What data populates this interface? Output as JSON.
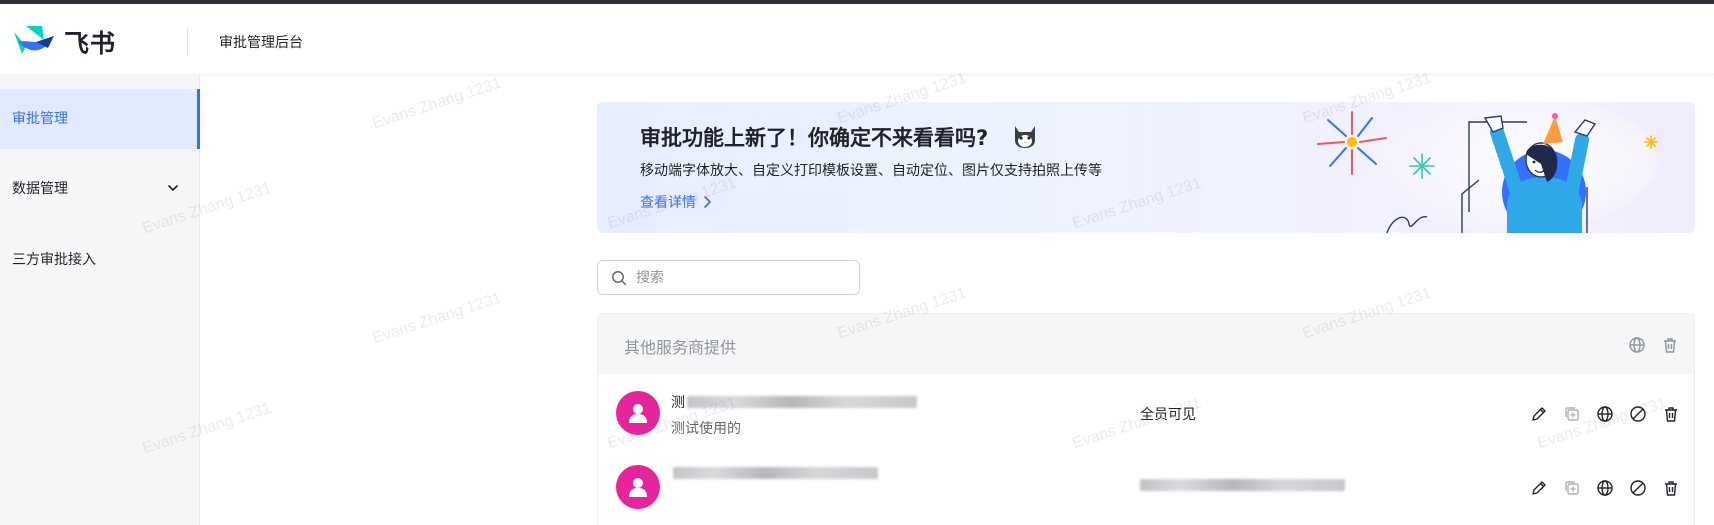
{
  "app": {
    "brand": "飞书",
    "header_title": "审批管理后台"
  },
  "sidebar": {
    "items": [
      {
        "label": "审批管理",
        "active": true
      },
      {
        "label": "数据管理",
        "expandable": true
      },
      {
        "label": "三方审批接入"
      }
    ]
  },
  "banner": {
    "title": "审批功能上新了！你确定不来看看吗?",
    "subtitle": "移动端字体放大、自定义打印模板设置、自动定位、图片仅支持拍照上传等",
    "link": "查看详情"
  },
  "search": {
    "placeholder": "搜索",
    "value": ""
  },
  "group": {
    "title": "其他服务商提供",
    "header_icons": [
      "globe-icon",
      "trash-icon"
    ],
    "rows": [
      {
        "name_prefix": "测",
        "description": "测试使用的",
        "visibility": "全员可见",
        "actions": [
          "edit-icon",
          "copy-icon",
          "globe-icon",
          "disable-icon",
          "trash-icon"
        ]
      },
      {
        "name_prefix": "",
        "description": "",
        "visibility": "",
        "actions": [
          "edit-icon",
          "copy-icon",
          "globe-icon",
          "disable-icon",
          "trash-icon"
        ]
      }
    ]
  },
  "watermark": "Evans Zhang 1231",
  "colors": {
    "accent": "#3370ff",
    "avatar": "#e8249c",
    "sidebar_bg": "#f5f6f7",
    "sidebar_active_bg": "#e1eaff"
  }
}
